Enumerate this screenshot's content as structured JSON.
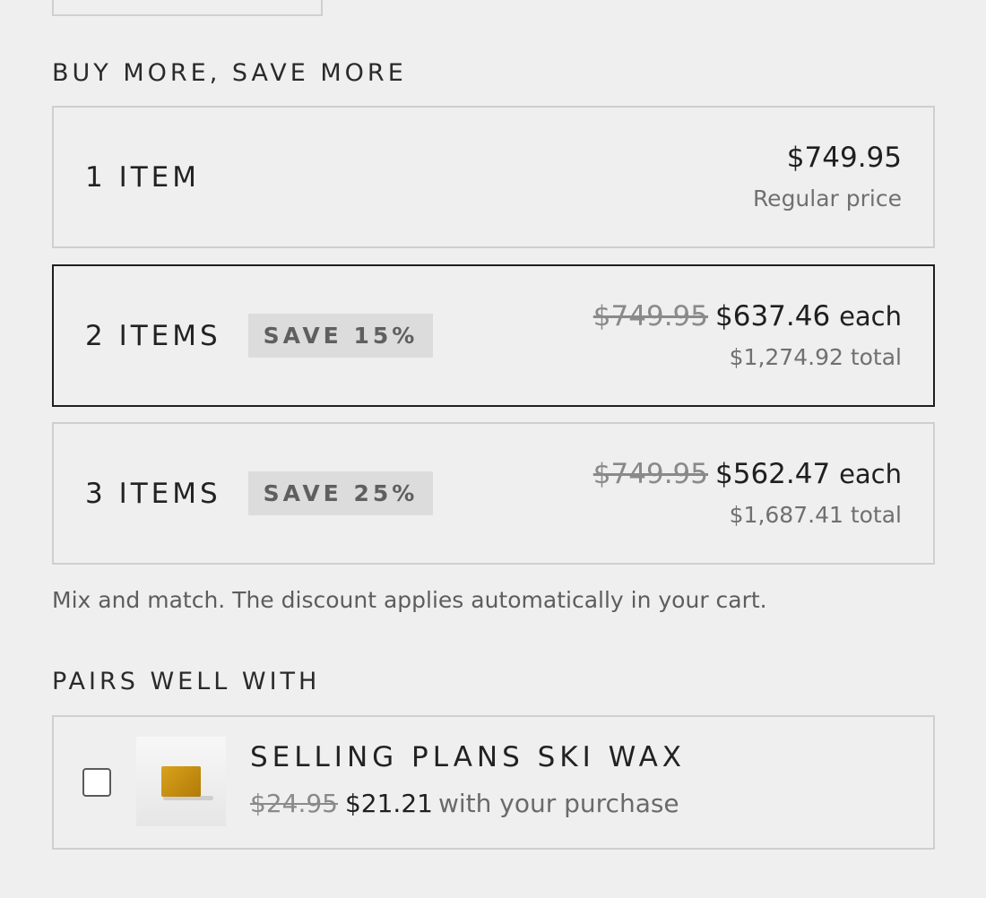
{
  "bundles": {
    "heading": "BUY MORE, SAVE MORE",
    "tiers": [
      {
        "label": "1 ITEM",
        "badge": "",
        "compare_price": "",
        "price": "$749.95",
        "price_suffix": "",
        "subtext": "Regular price",
        "selected": false
      },
      {
        "label": "2 ITEMS",
        "badge": "SAVE 15%",
        "compare_price": "$749.95",
        "price": "$637.46",
        "price_suffix": "each",
        "subtext": "$1,274.92 total",
        "selected": true
      },
      {
        "label": "3 ITEMS",
        "badge": "SAVE 25%",
        "compare_price": "$749.95",
        "price": "$562.47",
        "price_suffix": "each",
        "subtext": "$1,687.41 total",
        "selected": false
      }
    ],
    "note": "Mix and match. The discount applies automatically in your cart."
  },
  "pairs": {
    "heading": "PAIRS WELL WITH",
    "product": {
      "name": "SELLING PLANS SKI WAX",
      "compare_price": "$24.95",
      "price": "$21.21",
      "note": "with your purchase",
      "checked": false,
      "image_icon": "wax-bar-image"
    }
  },
  "colors": {
    "background": "#efefef",
    "border": "#cfcfcf",
    "selected_border": "#1f1f1f",
    "badge_bg": "#dcdcdc",
    "wax": "#d9a21c"
  }
}
